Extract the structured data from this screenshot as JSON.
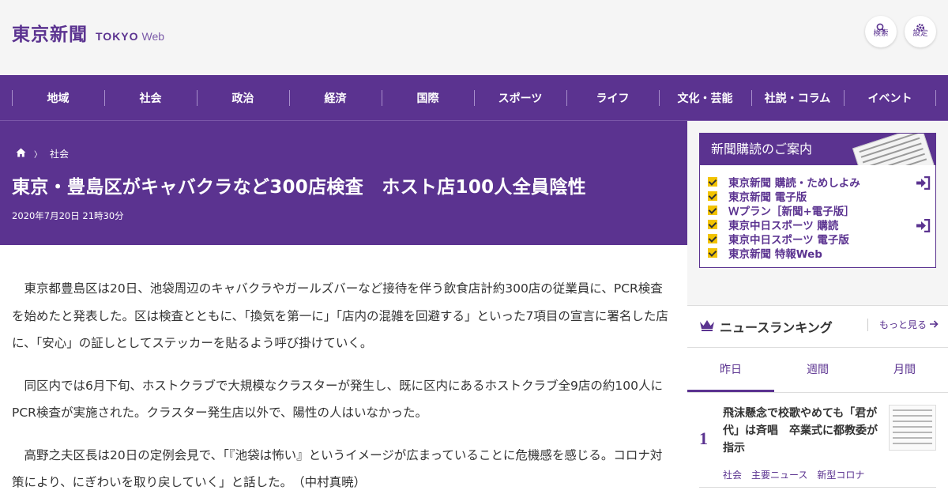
{
  "header": {
    "logo_kanji": "東京新聞",
    "logo_tokyo": "TOKYO",
    "logo_web": "Web",
    "search_label": "検索",
    "settings_label": "設定"
  },
  "nav": {
    "items": [
      {
        "label": "地域"
      },
      {
        "label": "社会"
      },
      {
        "label": "政治"
      },
      {
        "label": "経済"
      },
      {
        "label": "国際"
      },
      {
        "label": "スポーツ"
      },
      {
        "label": "ライフ"
      },
      {
        "label": "文化・芸能"
      },
      {
        "label": "社説・コラム"
      },
      {
        "label": "イベント"
      }
    ]
  },
  "article": {
    "breadcrumb": "社会",
    "breadcrumb_sep": "〉",
    "title": "東京・豊島区がキャバクラなど300店検査　ホスト店100人全員陰性",
    "date": "2020年7月20日 21時30分",
    "paragraphs": [
      "東京都豊島区は20日、池袋周辺のキャバクラやガールズバーなど接待を伴う飲食店計約300店の従業員に、PCR検査を始めたと発表した。区は検査とともに、「換気を第一に」「店内の混雑を回避する」といった7項目の宣言に署名した店に、「安心」の証しとしてステッカーを貼るよう呼び掛けていく。",
      "同区内では6月下旬、ホストクラブで大規模なクラスターが発生し、既に区内にあるホストクラブ全9店の約100人にPCR検査が実施された。クラスター発生店以外で、陽性の人はいなかった。",
      "高野之夫区長は20日の定例会見で、「『池袋は怖い』というイメージが広まっていることに危機感を感じる。コロナ対策により、にぎわいを取り戻していく」と話した。　（中村真暁）"
    ]
  },
  "subscription": {
    "heading": "新聞購読のご案内",
    "items": [
      {
        "label": "東京新聞 購読・ためしよみ"
      },
      {
        "label": "東京新聞 電子版"
      },
      {
        "label": "Ｗプラン［新聞+電子版］"
      },
      {
        "label": "東京中日スポーツ 購読"
      },
      {
        "label": "東京中日スポーツ 電子版"
      },
      {
        "label": "東京新聞 特報Web"
      }
    ]
  },
  "ranking": {
    "heading": "ニュースランキング",
    "more": "もっと見る",
    "tabs": [
      {
        "label": "昨日"
      },
      {
        "label": "週間"
      },
      {
        "label": "月間"
      }
    ],
    "items": [
      {
        "rank": "1",
        "title": "飛沫懸念で校歌やめても「君が代」は斉唱　卒業式に都教委が指示",
        "tags": [
          "社会",
          "主要ニュース",
          "新型コロナ"
        ]
      }
    ]
  },
  "colors": {
    "brand_purple": "#5b3390",
    "check_yellow": "#f2c300"
  }
}
